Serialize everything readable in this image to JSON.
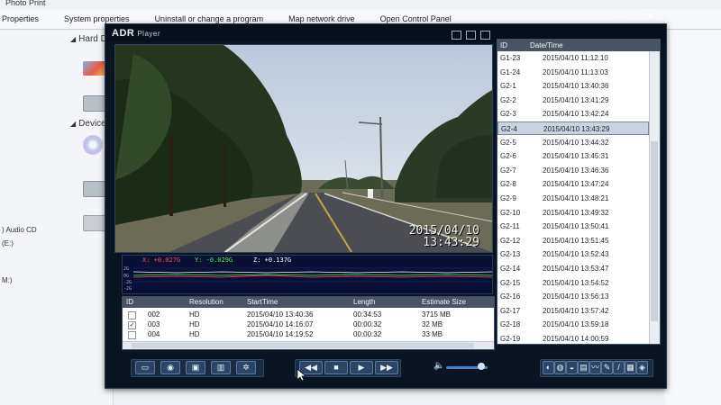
{
  "explorer": {
    "title": "Photo Print",
    "menu": [
      "Properties",
      "System properties",
      "Uninstall or change a program",
      "Map network drive",
      "Open Control Panel"
    ],
    "sections": [
      "Hard D",
      "Device"
    ],
    "left_labels": [
      ") Audio CD",
      "(E:)",
      "M:)"
    ]
  },
  "player": {
    "brand": "ADR",
    "subtitle": "Player",
    "close_glyph": "✕",
    "min_glyph": "—",
    "timestamp_date": "2015/04/10",
    "timestamp_time": "13:43:29"
  },
  "gsensor": {
    "x_label": "X: +0.027G",
    "y_label": "Y: -0.029G",
    "z_label": "Z: +0.137G",
    "ticks": [
      "2G",
      "0G",
      "-2G",
      "-2G"
    ],
    "colors": {
      "x": "#ff4d4d",
      "y": "#3cff3c",
      "z": "#ffffff"
    }
  },
  "files": {
    "headers": [
      "ID",
      "Resolution",
      "StartTime",
      "Length",
      "Estimate Size"
    ],
    "rows": [
      {
        "checked": false,
        "id": "002",
        "res": "HD",
        "start": "2015/04/10 13:40:36",
        "len": "00:34:53",
        "size": "3715 MB"
      },
      {
        "checked": true,
        "id": "003",
        "res": "HD",
        "start": "2015/04/10 14:16:07",
        "len": "00:00:32",
        "size": "32 MB"
      },
      {
        "checked": false,
        "id": "004",
        "res": "HD",
        "start": "2015/04/10 14:19:52",
        "len": "00:00:32",
        "size": "33 MB"
      }
    ]
  },
  "events": {
    "headers": [
      "ID",
      "Date/Time"
    ],
    "selected_index": 5,
    "rows": [
      {
        "id": "G1-23",
        "dt": "2015/04/10  11:12:10"
      },
      {
        "id": "G1-24",
        "dt": "2015/04/10  11:13:03"
      },
      {
        "id": "G2-1",
        "dt": "2015/04/10  13:40:36"
      },
      {
        "id": "G2-2",
        "dt": "2015/04/10  13:41:29"
      },
      {
        "id": "G2-3",
        "dt": "2015/04/10  13:42:24"
      },
      {
        "id": "G2-4",
        "dt": "2015/04/10  13:43:29"
      },
      {
        "id": "G2-5",
        "dt": "2015/04/10  13:44:32"
      },
      {
        "id": "G2-6",
        "dt": "2015/04/10  13:45:31"
      },
      {
        "id": "G2-7",
        "dt": "2015/04/10  13:46:36"
      },
      {
        "id": "G2-8",
        "dt": "2015/04/10  13:47:24"
      },
      {
        "id": "G2-9",
        "dt": "2015/04/10  13:48:21"
      },
      {
        "id": "G2-10",
        "dt": "2015/04/10  13:49:32"
      },
      {
        "id": "G2-11",
        "dt": "2015/04/10  13:50:41"
      },
      {
        "id": "G2-12",
        "dt": "2015/04/10  13:51:45"
      },
      {
        "id": "G2-13",
        "dt": "2015/04/10  13:52:43"
      },
      {
        "id": "G2-14",
        "dt": "2015/04/10  13:53:47"
      },
      {
        "id": "G2-15",
        "dt": "2015/04/10  13:54:52"
      },
      {
        "id": "G2-16",
        "dt": "2015/04/10  13:56:13"
      },
      {
        "id": "G2-17",
        "dt": "2015/04/10  13:57:42"
      },
      {
        "id": "G2-18",
        "dt": "2015/04/10  13:59:18"
      },
      {
        "id": "G2-19",
        "dt": "2015/04/10  14:00:59"
      }
    ]
  },
  "toolbar": {
    "left_buttons": [
      "folder-icon",
      "camera-icon",
      "save-icon",
      "delete-icon",
      "settings-icon"
    ],
    "left_glyphs": [
      "▭",
      "◉",
      "▣",
      "▥",
      "✲"
    ],
    "transport": [
      {
        "name": "rewind-icon",
        "glyph": "◀◀"
      },
      {
        "name": "stop-icon",
        "glyph": "■"
      },
      {
        "name": "play-icon",
        "glyph": "▶"
      },
      {
        "name": "fast-forward-icon",
        "glyph": "▶▶"
      }
    ],
    "volume_icon": "🔈",
    "volume_level": 0.85,
    "right_buttons": [
      "view-icon",
      "map-icon",
      "speed-icon",
      "gps-icon",
      "graph-icon",
      "zoom-icon",
      "edit-icon",
      "export-icon",
      "info-icon"
    ],
    "right_glyphs": [
      "◐",
      "◍",
      "◒",
      "▤",
      "〰",
      "✎",
      "/",
      "▦",
      "◈"
    ]
  }
}
